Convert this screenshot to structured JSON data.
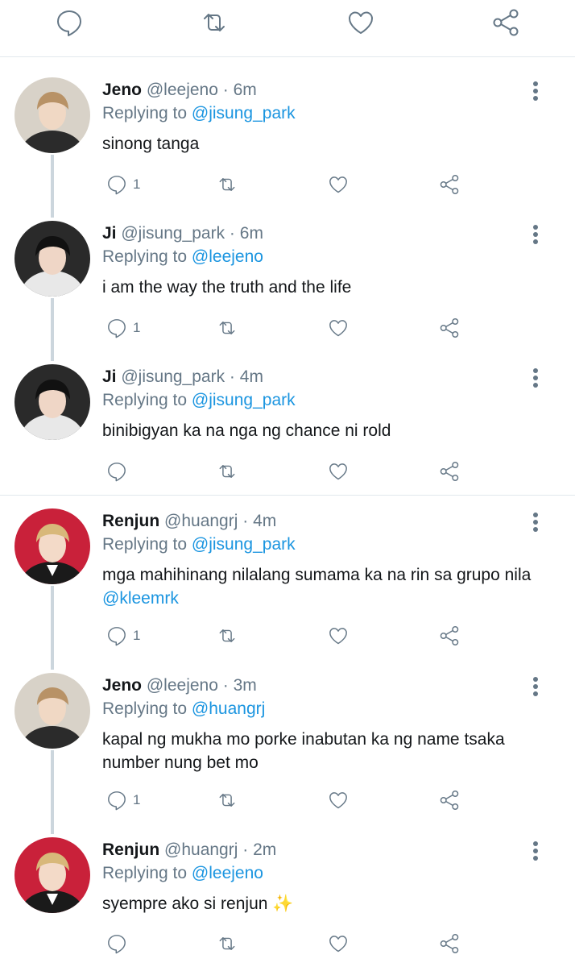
{
  "colors": {
    "link": "#1b95e0",
    "muted": "#657786",
    "text": "#14171a",
    "thread": "#ccd6dd"
  },
  "top_actions": [
    "reply-icon",
    "retweet-icon",
    "like-icon",
    "share-icon"
  ],
  "tweets": [
    {
      "name": "Jeno",
      "handle": "@leejeno",
      "dot": "·",
      "time": "6m",
      "replying_prefix": "Replying to",
      "replying_to": "@jisung_park",
      "text": "sinong tanga",
      "text_mention": "",
      "reply_count": "1"
    },
    {
      "name": "Ji",
      "handle": "@jisung_park",
      "dot": "·",
      "time": "6m",
      "replying_prefix": "Replying to",
      "replying_to": "@leejeno",
      "text": "i am the way the truth and the life",
      "text_mention": "",
      "reply_count": "1"
    },
    {
      "name": "Ji",
      "handle": "@jisung_park",
      "dot": "·",
      "time": "4m",
      "replying_prefix": "Replying to",
      "replying_to": "@jisung_park",
      "text": "binibigyan ka na nga ng chance ni rold",
      "text_mention": "",
      "reply_count": ""
    },
    {
      "name": "Renjun",
      "handle": "@huangrj",
      "dot": "·",
      "time": "4m",
      "replying_prefix": "Replying to",
      "replying_to": "@jisung_park",
      "text": "mga mahihinang nilalang sumama ka na rin sa grupo nila ",
      "text_mention": "@kleemrk",
      "reply_count": "1"
    },
    {
      "name": "Jeno",
      "handle": "@leejeno",
      "dot": "·",
      "time": "3m",
      "replying_prefix": "Replying to",
      "replying_to": "@huangrj",
      "text": "kapal ng mukha mo porke inabutan ka ng name tsaka number nung bet mo",
      "text_mention": "",
      "reply_count": "1"
    },
    {
      "name": "Renjun",
      "handle": "@huangrj",
      "dot": "·",
      "time": "2m",
      "replying_prefix": "Replying to",
      "replying_to": "@leejeno",
      "text": "syempre ako si renjun ✨",
      "text_mention": "",
      "reply_count": ""
    }
  ]
}
